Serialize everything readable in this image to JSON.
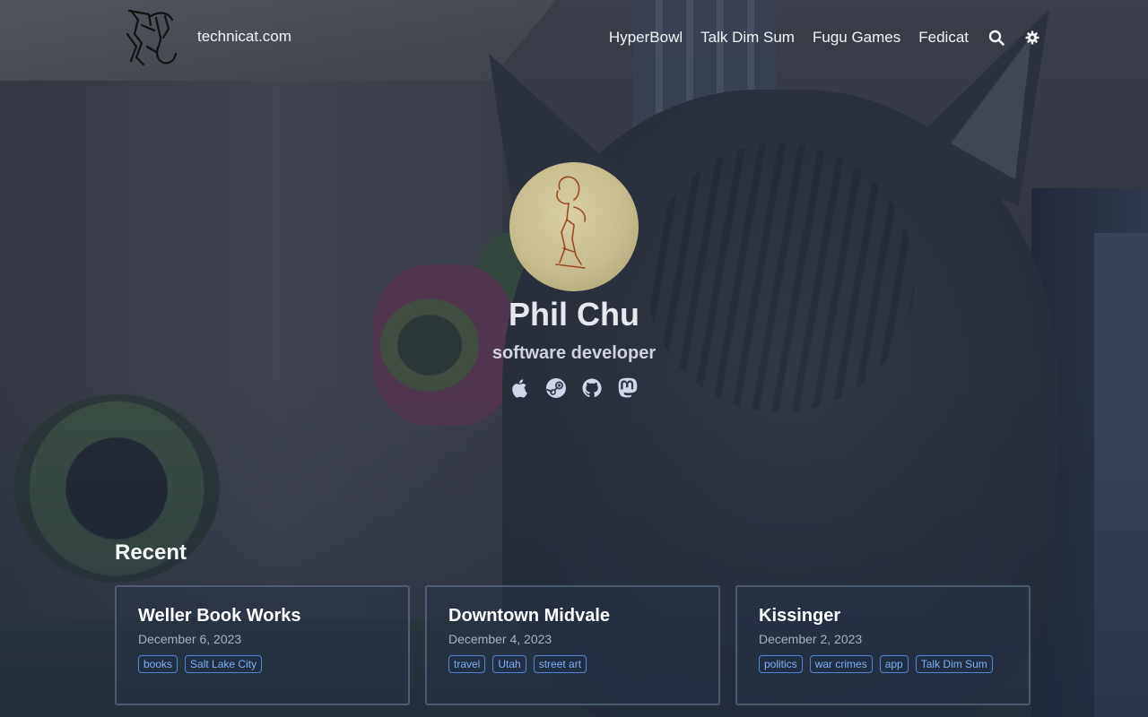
{
  "site": {
    "title": "technicat.com"
  },
  "nav": {
    "items": [
      {
        "label": "HyperBowl"
      },
      {
        "label": "Talk Dim Sum"
      },
      {
        "label": "Fugu Games"
      },
      {
        "label": "Fedicat"
      }
    ],
    "icons": [
      "search-icon",
      "settings-icon"
    ]
  },
  "profile": {
    "name": "Phil Chu",
    "subtitle": "software developer",
    "socials": [
      "apple-icon",
      "steam-icon",
      "github-icon",
      "mastodon-icon"
    ]
  },
  "recent": {
    "heading": "Recent",
    "posts": [
      {
        "title": "Weller Book Works",
        "date": "December 6, 2023",
        "tags": [
          "books",
          "Salt Lake City"
        ]
      },
      {
        "title": "Downtown Midvale",
        "date": "December 4, 2023",
        "tags": [
          "travel",
          "Utah",
          "street art"
        ]
      },
      {
        "title": "Kissinger",
        "date": "December 2, 2023",
        "tags": [
          "politics",
          "war crimes",
          "app",
          "Talk Dim Sum"
        ]
      }
    ]
  },
  "colors": {
    "tag_accent": "#7fb2f5",
    "overlay": "#182134"
  }
}
